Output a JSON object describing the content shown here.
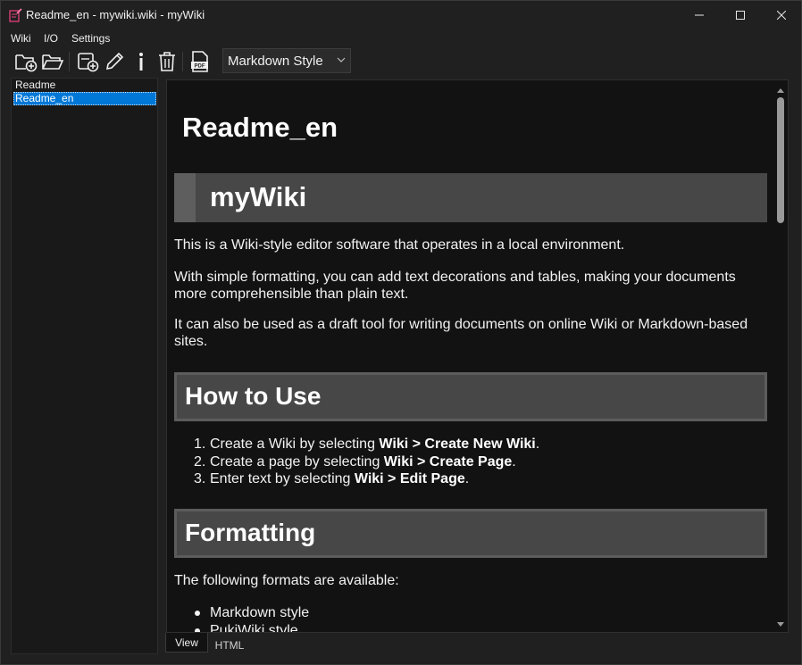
{
  "window": {
    "title": "Readme_en - mywiki.wiki - myWiki",
    "app_icon": "book-pencil-icon",
    "controls": [
      "minimize-icon",
      "maximize-icon",
      "close-icon"
    ]
  },
  "menu": {
    "items": [
      {
        "label": "Wiki"
      },
      {
        "label": "I/O"
      },
      {
        "label": "Settings"
      }
    ]
  },
  "toolbar": {
    "buttons": [
      {
        "name": "new-wiki-button",
        "icon": "folder-add-icon"
      },
      {
        "name": "open-wiki-button",
        "icon": "folder-open-icon"
      },
      {
        "name": "new-page-button",
        "icon": "page-add-icon"
      },
      {
        "name": "edit-page-button",
        "icon": "pencil-icon"
      },
      {
        "name": "info-button",
        "icon": "info-icon"
      },
      {
        "name": "delete-page-button",
        "icon": "trash-icon"
      },
      {
        "name": "export-pdf-button",
        "icon": "pdf-icon"
      }
    ],
    "style_select": {
      "value": "Markdown Style"
    }
  },
  "sidebar": {
    "pages": [
      {
        "label": "Readme",
        "selected": false
      },
      {
        "label": "Readme_en",
        "selected": true
      }
    ]
  },
  "document": {
    "title": "Readme_en",
    "h1": "myWiki",
    "intro": [
      "This is a Wiki-style editor software that operates in a local environment.",
      "With simple formatting, you can add text decorations and tables, making your documents more comprehensible than plain text.",
      "It can also be used as a draft tool for writing documents on online Wiki or Markdown-based sites."
    ],
    "howto": {
      "heading": "How to Use",
      "steps": [
        {
          "num": "1.",
          "pre": "Create a Wiki by selecting ",
          "bold": "Wiki > Create New Wiki",
          "post": "."
        },
        {
          "num": "2.",
          "pre": "Create a page by selecting ",
          "bold": "Wiki > Create Page",
          "post": "."
        },
        {
          "num": "3.",
          "pre": "Enter text by selecting ",
          "bold": "Wiki > Edit Page",
          "post": "."
        }
      ]
    },
    "formatting": {
      "heading": "Formatting",
      "intro": "The following formats are available:",
      "items": [
        "Markdown style",
        "PukiWiki style"
      ]
    }
  },
  "tabs": [
    {
      "label": "View",
      "active": true
    },
    {
      "label": "HTML",
      "active": false
    }
  ],
  "colors": {
    "selection": "#0078d7",
    "heading_bg": "#474747",
    "background": "#121212"
  }
}
